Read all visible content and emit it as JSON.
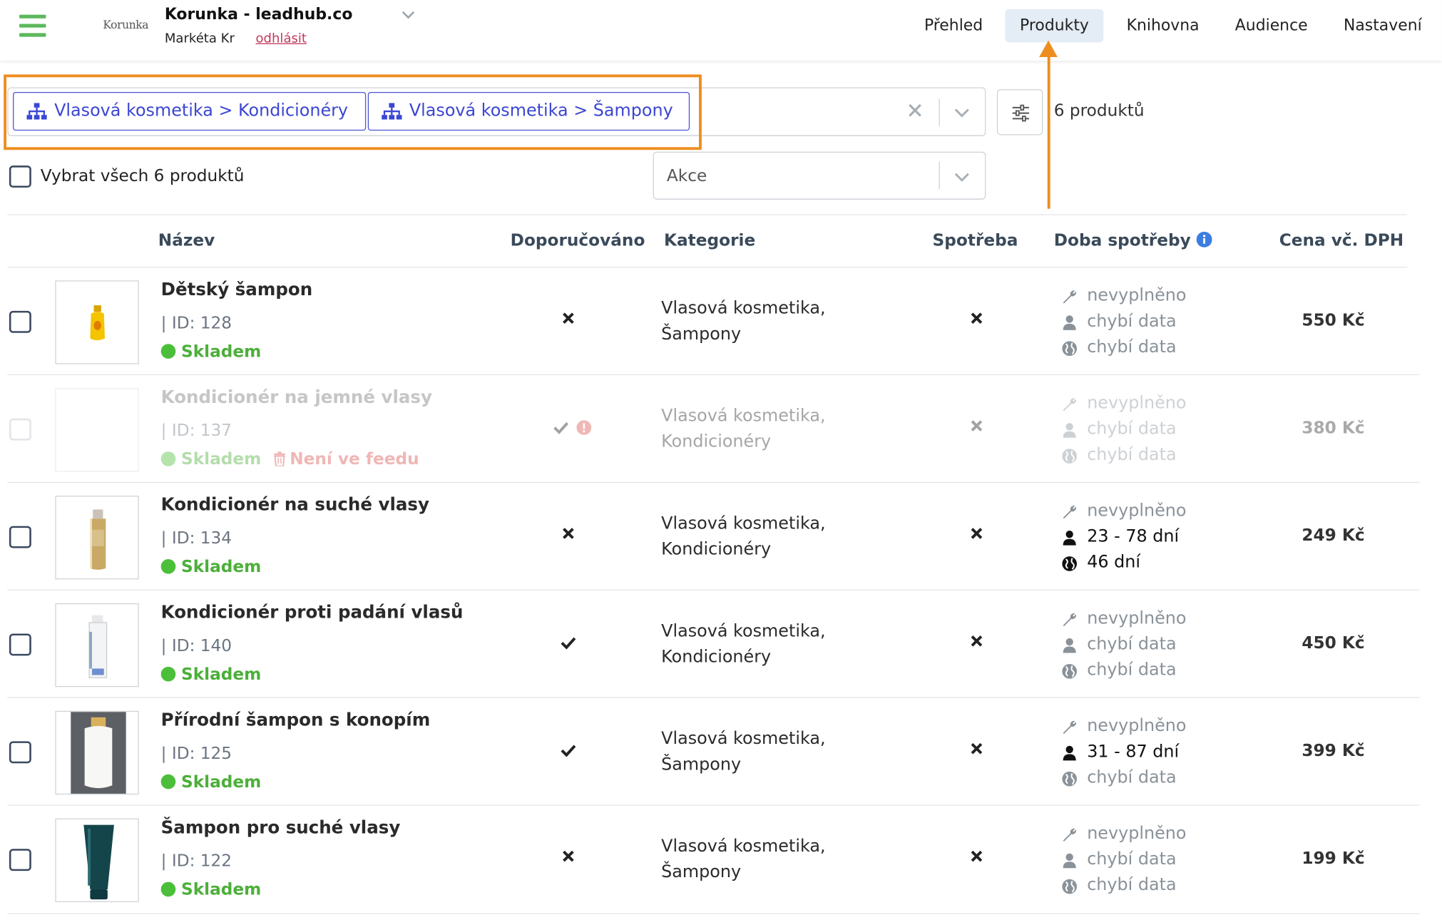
{
  "header": {
    "logo_text": "Korunka",
    "shop_title": "Korunka - leadhub.co",
    "user_name": "Markéta Kr",
    "logout_label": "odhlásit",
    "nav": [
      "Přehled",
      "Produkty",
      "Knihovna",
      "Audience",
      "Nastavení"
    ],
    "active_nav": "Produkty"
  },
  "filter": {
    "chips": [
      "Vlasová kosmetika > Kondicionéry",
      "Vlasová kosmetika > Šampony"
    ],
    "count_label": "6 produktů"
  },
  "select_all_label": "Vybrat všech 6 produktů",
  "actions_placeholder": "Akce",
  "columns": {
    "name": "Název",
    "recommended": "Doporučováno",
    "category": "Kategorie",
    "consumption": "Spotřeba",
    "consumption_time": "Doba spotřeby",
    "price": "Cena vč. DPH"
  },
  "products": [
    {
      "name": "Dětský šampon",
      "id": "| ID: 128",
      "stock": "Skladem",
      "recommended": "no",
      "category_l1": "Vlasová kosmetika,",
      "category_l2": "Šampony",
      "consumption": "no",
      "d1": "nevyplněno",
      "d2": "chybí data",
      "d3": "chybí data",
      "price": "550 Kč",
      "active": true
    },
    {
      "name": "Kondicionér na jemné vlasy",
      "id": "| ID: 137",
      "stock": "Skladem",
      "not_in_feed": "Není ve feedu",
      "recommended": "yes-warning",
      "category_l1": "Vlasová kosmetika,",
      "category_l2": "Kondicionéry",
      "consumption": "no",
      "d1": "nevyplněno",
      "d2": "chybí data",
      "d3": "chybí data",
      "price": "380 Kč",
      "active": false
    },
    {
      "name": "Kondicionér na suché vlasy",
      "id": "| ID: 134",
      "stock": "Skladem",
      "recommended": "no",
      "category_l1": "Vlasová kosmetika,",
      "category_l2": "Kondicionéry",
      "consumption": "no",
      "d1": "nevyplněno",
      "d2": "23 - 78 dní",
      "d3": "46 dní",
      "price": "249 Kč",
      "active": true
    },
    {
      "name": "Kondicionér proti padání vlasů",
      "id": "| ID: 140",
      "stock": "Skladem",
      "recommended": "yes",
      "category_l1": "Vlasová kosmetika,",
      "category_l2": "Kondicionéry",
      "consumption": "no",
      "d1": "nevyplněno",
      "d2": "chybí data",
      "d3": "chybí data",
      "price": "450 Kč",
      "active": true
    },
    {
      "name": "Přírodní šampon s konopím",
      "id": "| ID: 125",
      "stock": "Skladem",
      "recommended": "yes",
      "category_l1": "Vlasová kosmetika,",
      "category_l2": "Šampony",
      "consumption": "no",
      "d1": "nevyplněno",
      "d2": "31 - 87 dní",
      "d3": "chybí data",
      "price": "399 Kč",
      "active": true
    },
    {
      "name": "Šampon pro suché vlasy",
      "id": "| ID: 122",
      "stock": "Skladem",
      "recommended": "no",
      "category_l1": "Vlasová kosmetika,",
      "category_l2": "Šampony",
      "consumption": "no",
      "d1": "nevyplněno",
      "d2": "chybí data",
      "d3": "chybí data",
      "price": "199 Kč",
      "active": true
    }
  ],
  "colors": {
    "accent_green": "#5cb85c",
    "chip_blue": "#3b46d1",
    "highlight_orange": "#ee8d1f",
    "stock_green": "#4caf3a",
    "danger_red": "#d9534f",
    "logout_link": "#c0395a",
    "info_blue": "#3b7de0"
  },
  "icons": {
    "menu": "hamburger-icon",
    "chip": "sitemap-icon",
    "clear": "close-icon",
    "dropdown": "chevron-down-icon",
    "filter_settings": "sliders-icon",
    "info": "info-icon",
    "recommended_no": "x-mark-icon",
    "recommended_yes": "check-icon",
    "warning": "exclamation-circle-icon",
    "trash": "trash-icon",
    "manual": "wrench-icon",
    "user": "user-icon",
    "global": "globe-icon"
  }
}
